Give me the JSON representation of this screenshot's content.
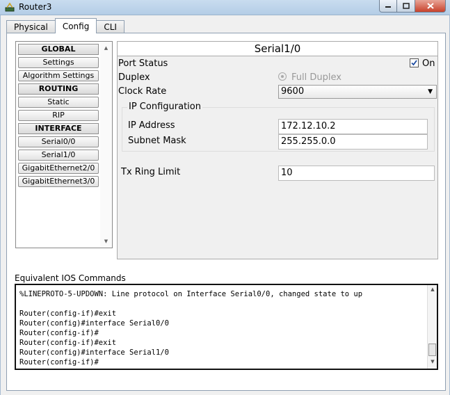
{
  "window": {
    "title": "Router3"
  },
  "tabs": [
    {
      "label": "Physical"
    },
    {
      "label": "Config"
    },
    {
      "label": "CLI"
    }
  ],
  "active_tab": "Config",
  "nav": {
    "items": [
      {
        "label": "GLOBAL",
        "kind": "header"
      },
      {
        "label": "Settings",
        "kind": "button"
      },
      {
        "label": "Algorithm Settings",
        "kind": "button"
      },
      {
        "label": "ROUTING",
        "kind": "header"
      },
      {
        "label": "Static",
        "kind": "button"
      },
      {
        "label": "RIP",
        "kind": "button"
      },
      {
        "label": "INTERFACE",
        "kind": "header"
      },
      {
        "label": "Serial0/0",
        "kind": "button"
      },
      {
        "label": "Serial1/0",
        "kind": "button"
      },
      {
        "label": "GigabitEthernet2/0",
        "kind": "button"
      },
      {
        "label": "GigabitEthernet3/0",
        "kind": "button"
      }
    ]
  },
  "panel": {
    "title": "Serial1/0",
    "port_status": {
      "label": "Port Status",
      "checkbox_label": "On",
      "checked": true
    },
    "duplex": {
      "label": "Duplex",
      "option_label": "Full Duplex"
    },
    "clock_rate": {
      "label": "Clock Rate",
      "value": "9600"
    },
    "ip_config": {
      "legend": "IP Configuration",
      "ip_address": {
        "label": "IP Address",
        "value": "172.12.10.2"
      },
      "subnet_mask": {
        "label": "Subnet Mask",
        "value": "255.255.0.0"
      }
    },
    "tx_ring_limit": {
      "label": "Tx Ring Limit",
      "value": "10"
    }
  },
  "ios": {
    "label": "Equivalent IOS Commands",
    "console_text": "%LINEPROTO-5-UPDOWN: Line protocol on Interface Serial0/0, changed state to up\n\nRouter(config-if)#exit\nRouter(config)#interface Serial0/0\nRouter(config-if)#\nRouter(config-if)#exit\nRouter(config)#interface Serial1/0\nRouter(config-if)#"
  },
  "icons": {
    "app": "router-icon",
    "minimize": "minimize-icon",
    "maximize": "maximize-icon",
    "close": "close-icon"
  }
}
